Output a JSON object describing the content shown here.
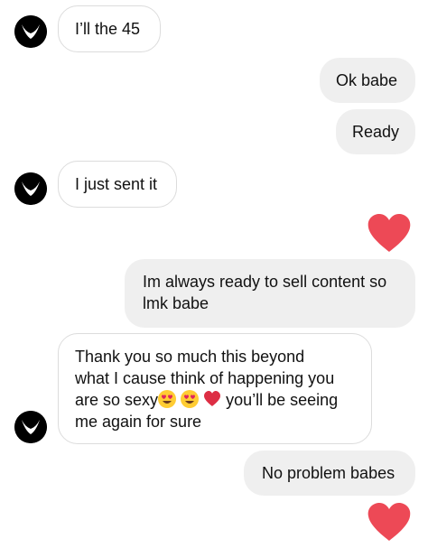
{
  "messages": [
    {
      "from": "them",
      "text": "I’ll the 45"
    },
    {
      "from": "me",
      "text": "Ok babe"
    },
    {
      "from": "me",
      "text": "Ready"
    },
    {
      "from": "them",
      "text": "I just sent it"
    },
    {
      "from": "me",
      "type": "reaction",
      "icon": "heart-icon"
    },
    {
      "from": "me",
      "lines": [
        "Im always ready to sell content so",
        "lmk babe"
      ]
    },
    {
      "from": "them",
      "lines": [
        "Thank you  so much this beyond",
        "what I cause think of happening you",
        "are so sexy",
        "you’ll be seeing",
        "me again for sure"
      ],
      "emojis": [
        "heart-eyes-emoji",
        "heart-eyes-emoji",
        "red-heart-emoji"
      ]
    },
    {
      "from": "me",
      "text": "No problem babes"
    },
    {
      "from": "me",
      "type": "reaction",
      "icon": "heart-icon"
    }
  ],
  "colors": {
    "incoming_bubble": "#ffffff",
    "incoming_border": "#dcdcdc",
    "outgoing_bubble": "#efefef",
    "heart": "#ed4956",
    "avatar": "#000000"
  }
}
